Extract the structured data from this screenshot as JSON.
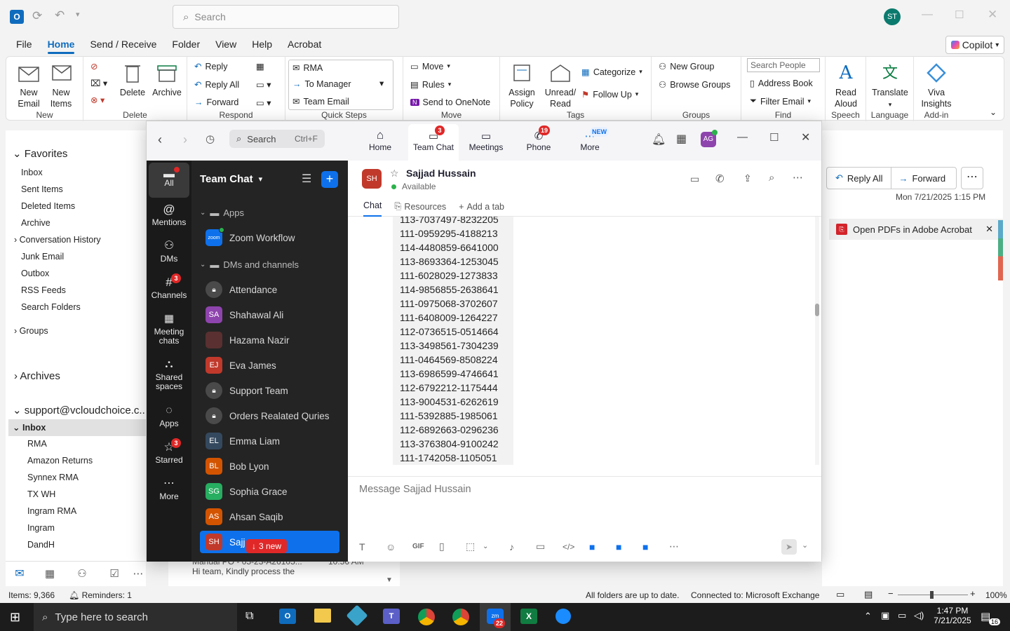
{
  "outlook": {
    "search_placeholder": "Search",
    "user_initials": "ST",
    "menu": [
      "File",
      "Home",
      "Send / Receive",
      "Folder",
      "View",
      "Help",
      "Acrobat"
    ],
    "copilot": "Copilot",
    "ribbon": {
      "new_email": "New\nEmail",
      "new_items": "New\nItems",
      "delete": "Delete",
      "archive": "Archive",
      "reply": "Reply",
      "reply_all": "Reply All",
      "forward": "Forward",
      "qs_rma": "RMA",
      "qs_manager": "To Manager",
      "qs_team": "Team Email",
      "move": "Move",
      "rules": "Rules",
      "onenote": "Send to OneNote",
      "assign_policy": "Assign\nPolicy",
      "unread_read": "Unread/\nRead",
      "categorize": "Categorize",
      "follow_up": "Follow Up",
      "new_group": "New Group",
      "browse_groups": "Browse Groups",
      "search_people": "Search People",
      "address_book": "Address Book",
      "filter_email": "Filter Email",
      "read_aloud": "Read\nAloud",
      "translate": "Translate",
      "viva": "Viva\nInsights",
      "g_new": "New",
      "g_delete": "Delete",
      "g_respond": "Respond",
      "g_quicksteps": "Quick Steps",
      "g_move": "Move",
      "g_tags": "Tags",
      "g_groups": "Groups",
      "g_find": "Find",
      "g_speech": "Speech",
      "g_language": "Language",
      "g_addin": "Add-in"
    },
    "folders": {
      "favorites": "Favorites",
      "inbox": "Inbox",
      "sent": "Sent Items",
      "deleted": "Deleted Items",
      "archive": "Archive",
      "conv_history": "Conversation History",
      "junk": "Junk Email",
      "outbox": "Outbox",
      "rss": "RSS Feeds",
      "search_folders": "Search Folders",
      "groups": "Groups",
      "archives": "Archives",
      "account": "support@vcloudchoice.c...",
      "inbox2": "Inbox",
      "sub": [
        "RMA",
        "Amazon Returns",
        "Synnex RMA",
        "TX WH",
        "Ingram RMA",
        "Ingram",
        "DandH"
      ]
    },
    "reading": {
      "reply_all": "Reply All",
      "forward": "Forward",
      "date": "Mon 7/21/2025 1:15 PM",
      "acrobat": "Open PDFs in Adobe Acrobat"
    },
    "preview": {
      "subject": "Manual PO - 05-23-A26105...",
      "time": "10:56 AM",
      "body": "Hi team,  Kindly process the"
    },
    "status": {
      "items": "Items: 9,366",
      "reminders": "Reminders: 1",
      "sync": "All folders are up to date.",
      "connected": "Connected to: Microsoft Exchange",
      "zoom": "100%"
    }
  },
  "zoom": {
    "search": "Search",
    "shortcut": "Ctrl+F",
    "tabs": [
      {
        "label": "Home"
      },
      {
        "label": "Team Chat",
        "badge": "3"
      },
      {
        "label": "Meetings"
      },
      {
        "label": "Phone",
        "badge": "19"
      },
      {
        "label": "More",
        "badge": "NEW"
      }
    ],
    "avatar": "AG",
    "rail": [
      {
        "label": "All"
      },
      {
        "label": "Mentions"
      },
      {
        "label": "DMs"
      },
      {
        "label": "Channels",
        "badge": "3"
      },
      {
        "label": "Meeting\nchats"
      },
      {
        "label": "Shared\nspaces"
      },
      {
        "label": "Apps"
      },
      {
        "label": "Starred",
        "badge": "3"
      },
      {
        "label": "More"
      }
    ],
    "list_title": "Team Chat",
    "section_apps": "Apps",
    "zoom_workflow": "Zoom Workflow",
    "section_dms": "DMs and channels",
    "contacts": [
      {
        "initials": "",
        "name": "Attendance",
        "color": "#4a4a4a",
        "lock": true
      },
      {
        "initials": "SA",
        "name": "Shahawal Ali",
        "color": "#8e44ad"
      },
      {
        "initials": "",
        "name": "Hazama Nazir",
        "color": "#5a3030"
      },
      {
        "initials": "EJ",
        "name": "Eva James",
        "color": "#c0392b"
      },
      {
        "initials": "",
        "name": "Support Team",
        "color": "#4a4a4a",
        "lock": true
      },
      {
        "initials": "",
        "name": "Orders Realated Quries",
        "color": "#4a4a4a",
        "lock": true
      },
      {
        "initials": "EL",
        "name": "Emma Liam",
        "color": "#34495e"
      },
      {
        "initials": "BL",
        "name": "Bob Lyon",
        "color": "#d35400"
      },
      {
        "initials": "SG",
        "name": "Sophia Grace",
        "color": "#27ae60"
      },
      {
        "initials": "AS",
        "name": "Ahsan Saqib",
        "color": "#d35400"
      },
      {
        "initials": "SH",
        "name": "Sajj",
        "color": "#c0392b"
      }
    ],
    "new_pill": "3 new",
    "chat_name": "Sajjad Hussain",
    "chat_initials": "SH",
    "presence": "Available",
    "chat_tabs": {
      "chat": "Chat",
      "resources": "Resources",
      "add": "Add a tab"
    },
    "messages": [
      "113-7037497-8232205",
      "111-0959295-4188213",
      "114-4480859-6641000",
      "113-8693364-1253045",
      "111-6028029-1273833",
      "114-9856855-2638641",
      "111-0975068-3702607",
      "111-6408009-1264227",
      "112-0736515-0514664",
      "113-3498561-7304239",
      "111-0464569-8508224",
      "113-6986599-4746641",
      "112-6792212-1175444",
      "113-9004531-6262619",
      "111-5392885-1985061",
      "112-6892663-0296236",
      "113-3763804-9100242",
      "111-1742058-1105051"
    ],
    "compose_placeholder": "Message Sajjad Hussain"
  },
  "taskbar": {
    "search": "Type here to search",
    "time": "1:47 PM",
    "date": "7/21/2025",
    "notif": "16",
    "zoom_badge": "22"
  }
}
